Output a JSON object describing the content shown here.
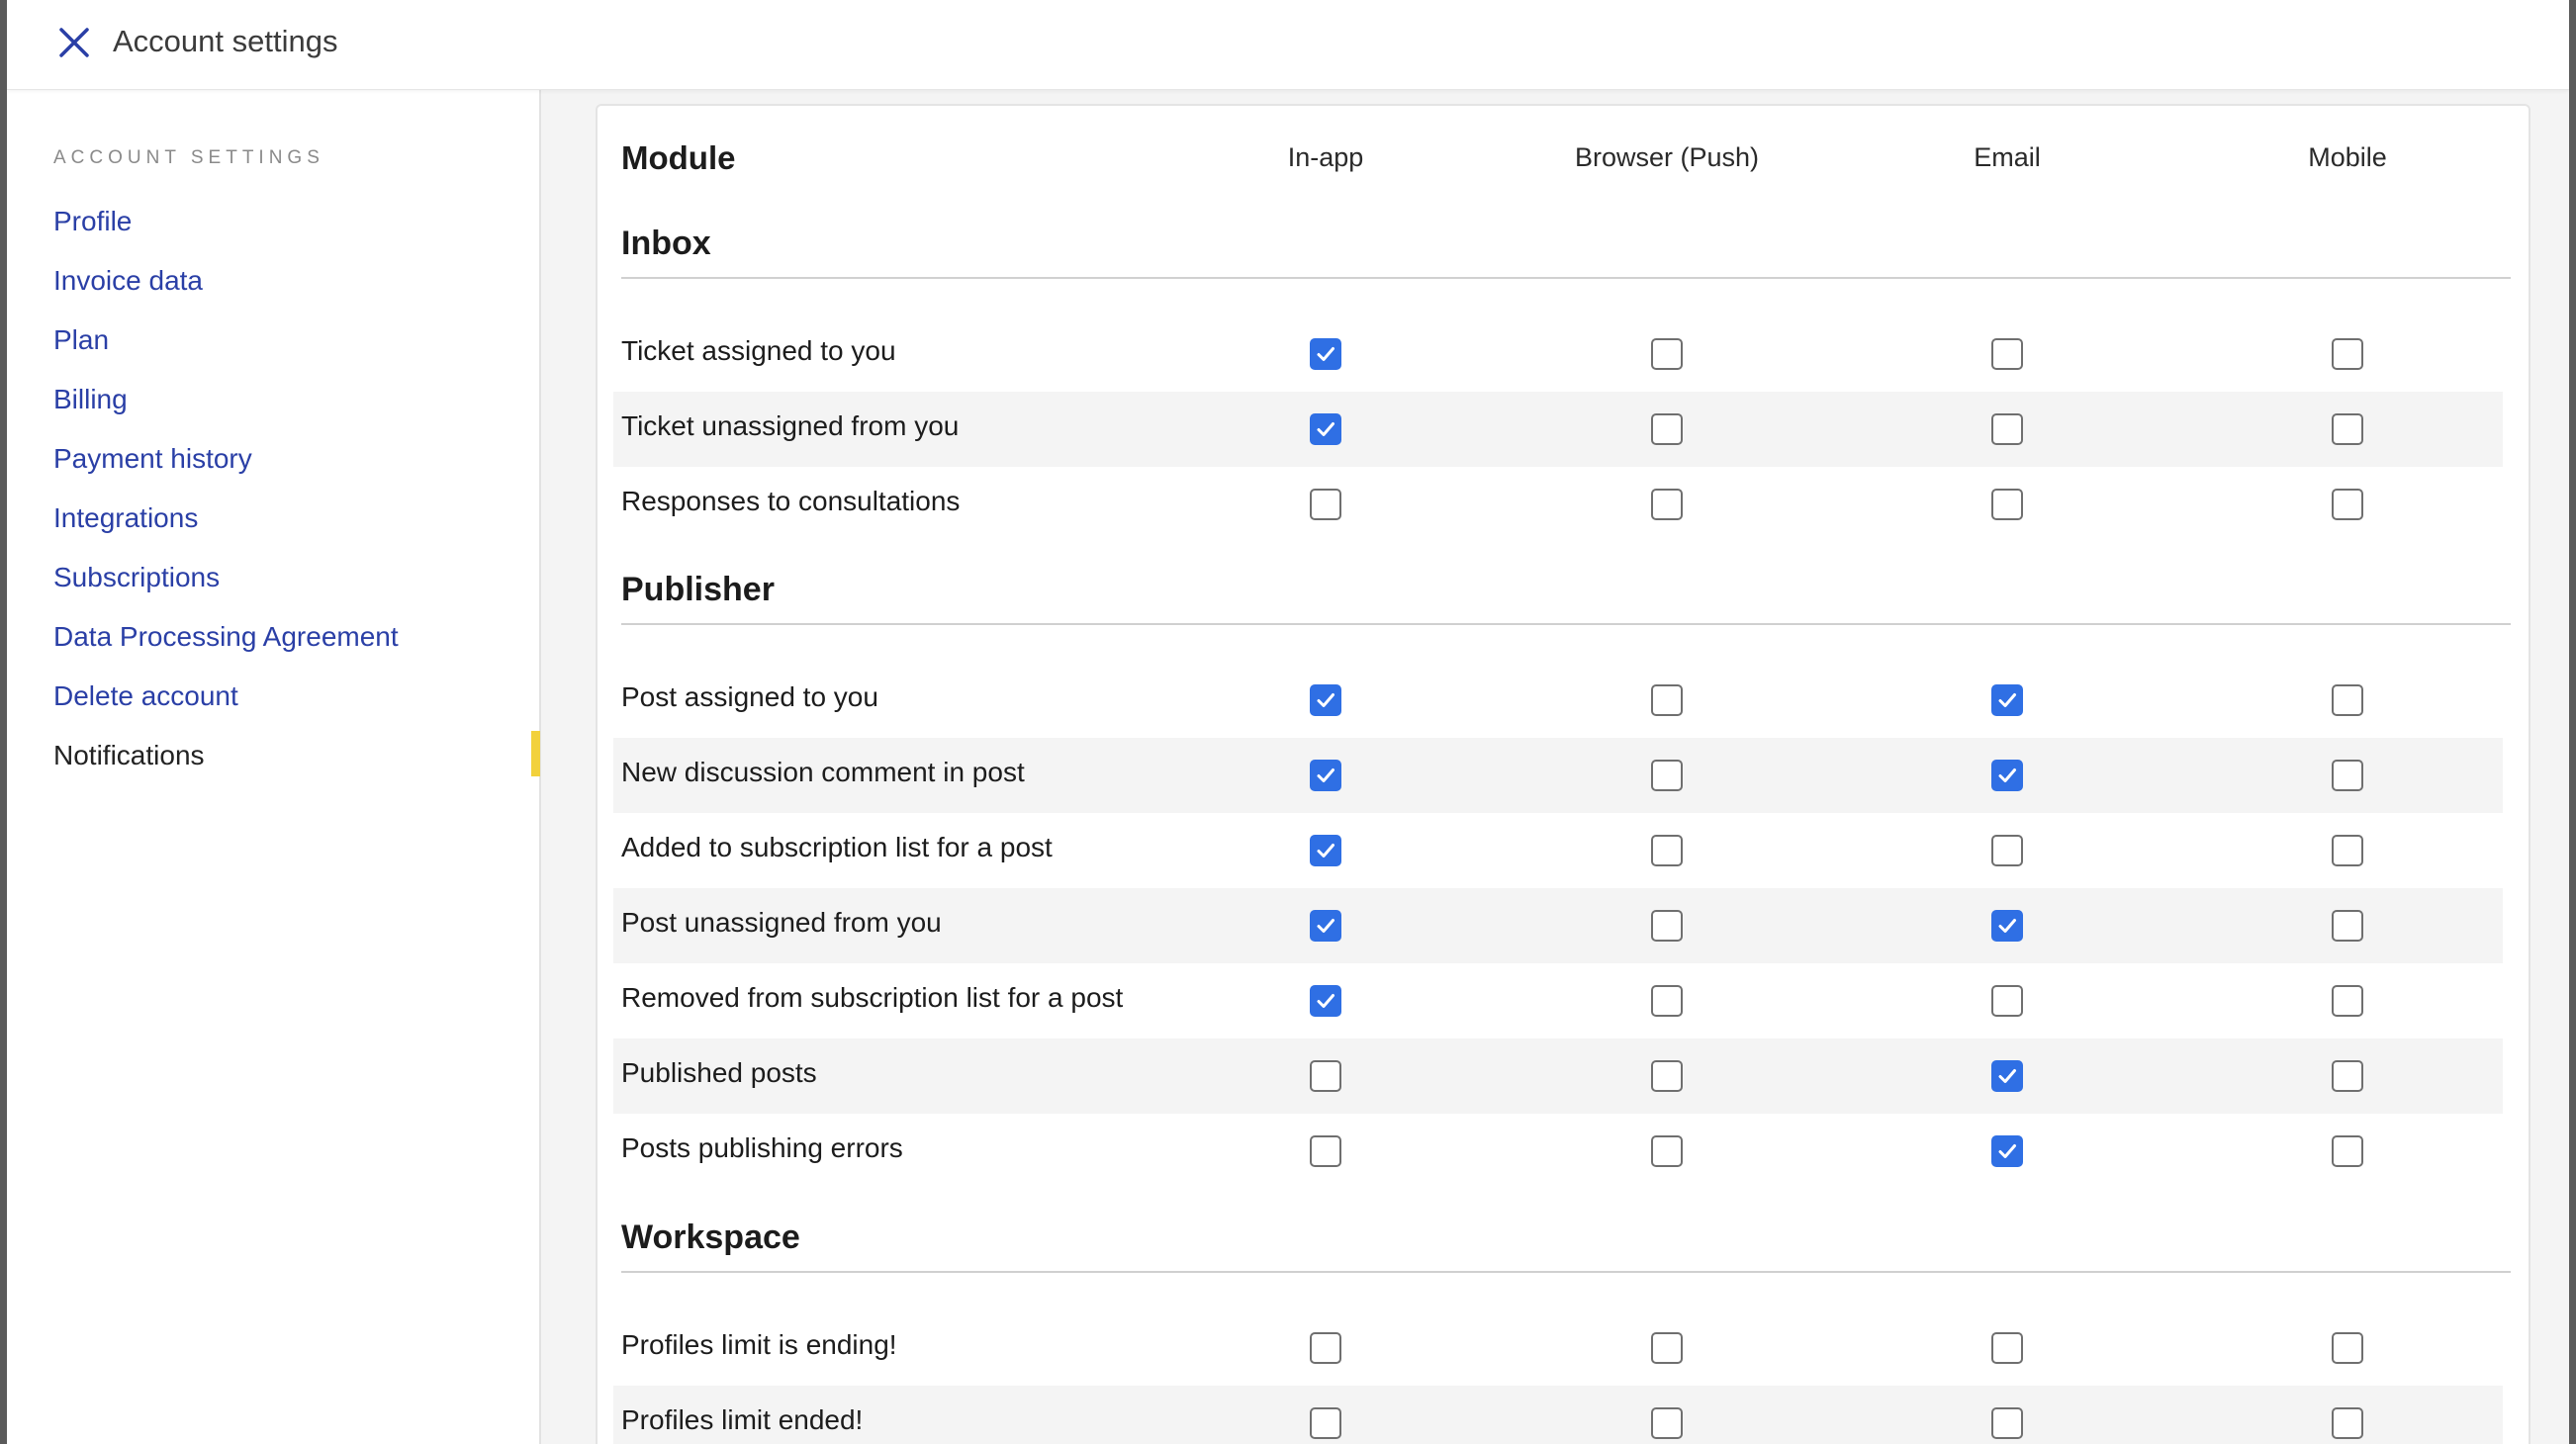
{
  "topbar": {
    "title": "Account settings"
  },
  "sidebar": {
    "heading": "ACCOUNT SETTINGS",
    "items": [
      {
        "label": "Profile"
      },
      {
        "label": "Invoice data"
      },
      {
        "label": "Plan"
      },
      {
        "label": "Billing"
      },
      {
        "label": "Payment history"
      },
      {
        "label": "Integrations"
      },
      {
        "label": "Subscriptions"
      },
      {
        "label": "Data Processing Agreement"
      },
      {
        "label": "Delete account"
      },
      {
        "label": "Notifications",
        "active": true
      }
    ]
  },
  "table": {
    "module_label": "Module",
    "columns": [
      "In-app",
      "Browser (Push)",
      "Email",
      "Mobile"
    ],
    "sections": [
      {
        "title": "Inbox",
        "rows": [
          {
            "label": "Ticket assigned to you",
            "checks": [
              true,
              false,
              false,
              false
            ]
          },
          {
            "label": "Ticket unassigned from you",
            "checks": [
              true,
              false,
              false,
              false
            ]
          },
          {
            "label": "Responses to consultations",
            "checks": [
              false,
              false,
              false,
              false
            ]
          }
        ]
      },
      {
        "title": "Publisher",
        "rows": [
          {
            "label": "Post assigned to you",
            "checks": [
              true,
              false,
              true,
              false
            ]
          },
          {
            "label": "New discussion comment in post",
            "checks": [
              true,
              false,
              true,
              false
            ]
          },
          {
            "label": "Added to subscription list for a post",
            "checks": [
              true,
              false,
              false,
              false
            ]
          },
          {
            "label": "Post unassigned from you",
            "checks": [
              true,
              false,
              true,
              false
            ]
          },
          {
            "label": "Removed from subscription list for a post",
            "checks": [
              true,
              false,
              false,
              false
            ]
          },
          {
            "label": "Published posts",
            "checks": [
              false,
              false,
              true,
              false
            ]
          },
          {
            "label": "Posts publishing errors",
            "checks": [
              false,
              false,
              true,
              false
            ]
          }
        ]
      },
      {
        "title": "Workspace",
        "rows": [
          {
            "label": "Profiles limit is ending!",
            "checks": [
              false,
              false,
              false,
              false
            ]
          },
          {
            "label": "Profiles limit ended!",
            "checks": [
              false,
              false,
              false,
              false
            ]
          }
        ]
      }
    ]
  },
  "colors": {
    "accent": "#2f6fe4",
    "link": "#2a3fa6",
    "active_indicator": "#f2d13c"
  }
}
